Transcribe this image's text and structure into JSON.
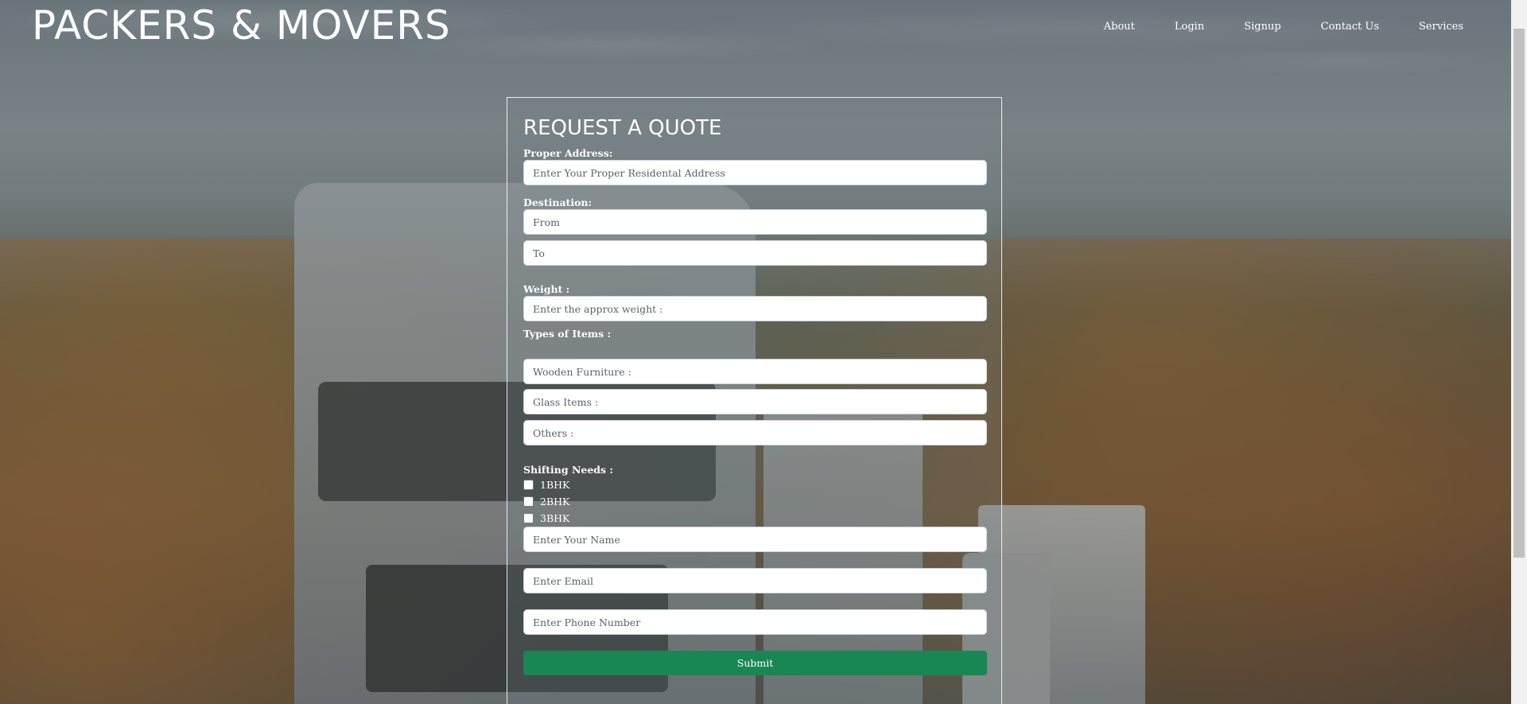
{
  "brand": {
    "title": "PACKERS & MOVERS"
  },
  "nav": {
    "items": [
      {
        "label": "About"
      },
      {
        "label": "Login"
      },
      {
        "label": "Signup"
      },
      {
        "label": "Contact Us"
      },
      {
        "label": "Services"
      }
    ]
  },
  "form": {
    "title": "REQUEST A QUOTE",
    "address": {
      "label": "Proper Address:",
      "placeholder": "Enter Your Proper Residental Address",
      "value": ""
    },
    "destination": {
      "label": "Destination:",
      "from_placeholder": "From",
      "to_placeholder": "To"
    },
    "weight": {
      "label": "Weight :",
      "placeholder": "Enter the approx weight :"
    },
    "items": {
      "label": "Types of Items :",
      "wooden_placeholder": "Wooden Furniture :",
      "glass_placeholder": "Glass Items :",
      "others_placeholder": "Others :"
    },
    "shifting": {
      "label": "Shifting Needs :",
      "options": [
        {
          "label": "1BHK",
          "checked": false
        },
        {
          "label": "2BHK",
          "checked": false
        },
        {
          "label": "3BHK",
          "checked": false
        }
      ]
    },
    "name_placeholder": "Enter Your Name",
    "email_placeholder": "Enter Email",
    "phone_placeholder": "Enter Phone Number",
    "submit_label": "Submit"
  },
  "colors": {
    "submit_bg": "#198754",
    "text": "#ffffff",
    "input_border": "#ced4da"
  }
}
